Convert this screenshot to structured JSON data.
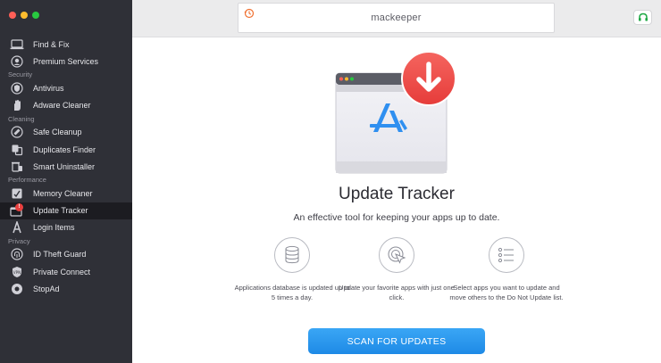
{
  "window": {
    "traffic_lights": [
      "close",
      "minimize",
      "zoom"
    ]
  },
  "sidebar": {
    "items": [
      {
        "label": "Find & Fix",
        "icon": "laptop-icon"
      },
      {
        "label": "Premium Services",
        "icon": "headset-icon"
      }
    ],
    "sections": [
      {
        "title": "Security",
        "items": [
          {
            "label": "Antivirus",
            "icon": "shield-icon"
          },
          {
            "label": "Adware Cleaner",
            "icon": "hand-icon"
          }
        ]
      },
      {
        "title": "Cleaning",
        "items": [
          {
            "label": "Safe Cleanup",
            "icon": "broom-icon"
          },
          {
            "label": "Duplicates Finder",
            "icon": "duplicate-icon"
          },
          {
            "label": "Smart Uninstaller",
            "icon": "trash-icon"
          }
        ]
      },
      {
        "title": "Performance",
        "items": [
          {
            "label": "Memory Cleaner",
            "icon": "memory-icon"
          },
          {
            "label": "Update Tracker",
            "icon": "update-icon",
            "active": true,
            "badge": "!"
          },
          {
            "label": "Login Items",
            "icon": "login-icon"
          }
        ]
      },
      {
        "title": "Privacy",
        "items": [
          {
            "label": "ID Theft Guard",
            "icon": "fingerprint-icon"
          },
          {
            "label": "Private Connect",
            "icon": "vpn-icon"
          },
          {
            "label": "StopAd",
            "icon": "stopad-icon"
          }
        ]
      }
    ]
  },
  "header": {
    "brand": "mackeeper"
  },
  "main": {
    "title": "Update Tracker",
    "subtitle": "An effective tool for keeping your apps up to date.",
    "features": [
      {
        "icon": "database-icon",
        "text": "Applications database is updated up to 5 times a day."
      },
      {
        "icon": "click-icon",
        "text": "Update your favorite apps with just one click."
      },
      {
        "icon": "list-icon",
        "text": "Select apps you want to update and move others to the Do Not Update list."
      }
    ],
    "scan_button": "SCAN FOR UPDATES"
  },
  "colors": {
    "accent": "#2196f3",
    "sidebar": "#2f3037",
    "badge": "#e8403f"
  }
}
